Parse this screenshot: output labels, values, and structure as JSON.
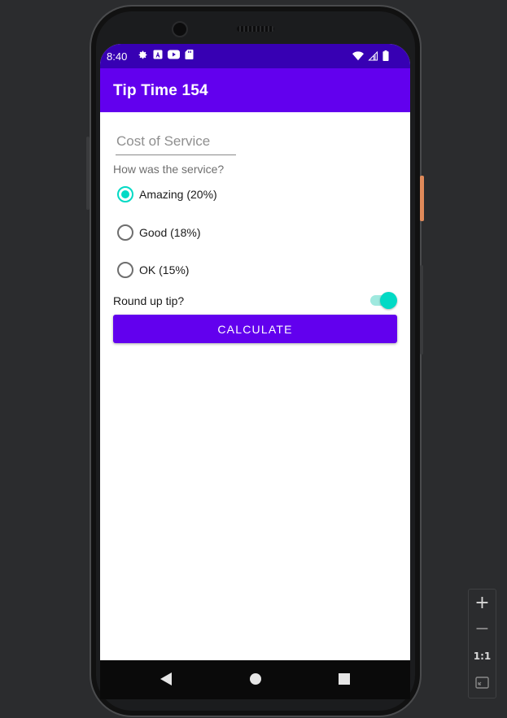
{
  "status_bar": {
    "time": "8:40",
    "left_icons": [
      "gear-icon",
      "a-badge-icon",
      "youtube-icon",
      "sd-card-icon"
    ],
    "right_icons": [
      "wifi-icon",
      "cell-signal-icon",
      "battery-icon"
    ]
  },
  "app_bar": {
    "title": "Tip Time 154"
  },
  "form": {
    "cost_placeholder": "Cost of Service",
    "cost_value": "",
    "question": "How was the service?",
    "options": [
      {
        "label": "Amazing (20%)",
        "checked": true
      },
      {
        "label": "Good (18%)",
        "checked": false
      },
      {
        "label": "OK (15%)",
        "checked": false
      }
    ],
    "round_up_label": "Round up tip?",
    "round_up_on": true,
    "calculate_label": "CALCULATE"
  },
  "nav_bar": {
    "buttons": [
      "back-icon",
      "home-icon",
      "recents-icon"
    ]
  },
  "zoom_panel": {
    "zoom_in": "+",
    "zoom_out": "−",
    "actual_size": "1:1",
    "fit": "fit-screen-icon"
  },
  "colors": {
    "primary": "#6200ee",
    "primary_dark": "#3700b3",
    "accent": "#03dac5"
  }
}
